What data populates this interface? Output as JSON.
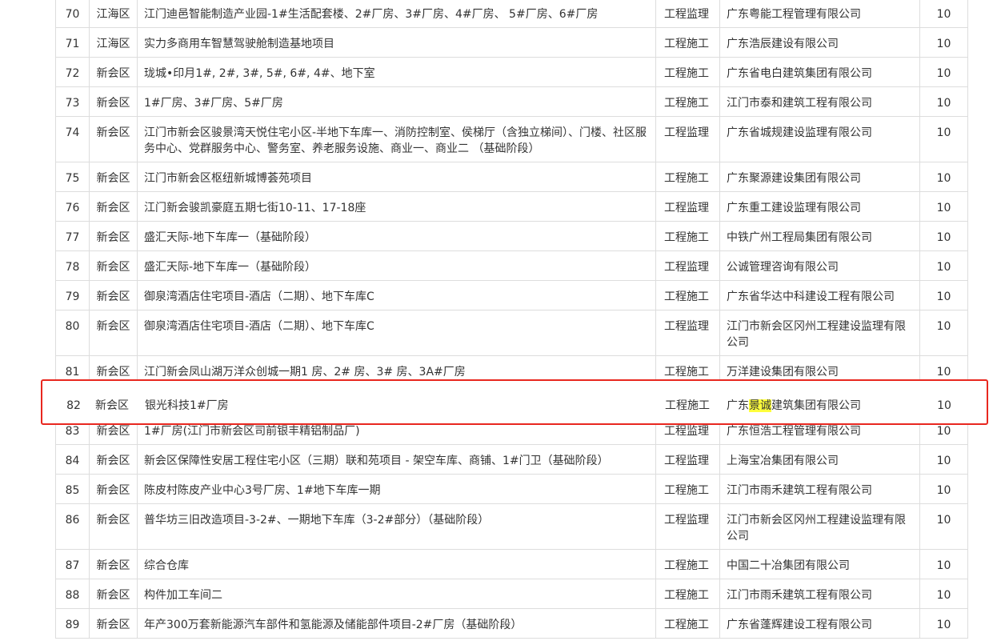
{
  "colors": {
    "border": "#dddddd",
    "text": "#333333",
    "highlight_box": "#e8271f",
    "text_highlight": "#ffff3c"
  },
  "rows": [
    {
      "num": "70",
      "district": "江海区",
      "project": "江门迪邑智能制造产业园-1#生活配套楼、2#厂房、3#厂房、4#厂房、 5#厂房、6#厂房",
      "type": "工程监理",
      "company": "广东粤能工程管理有限公司",
      "score": "10"
    },
    {
      "num": "71",
      "district": "江海区",
      "project": "实力多商用车智慧驾驶舱制造基地项目",
      "type": "工程施工",
      "company": "广东浩辰建设有限公司",
      "score": "10"
    },
    {
      "num": "72",
      "district": "新会区",
      "project": "珑城•印月1#, 2#, 3#, 5#, 6#, 4#、地下室",
      "type": "工程施工",
      "company": "广东省电白建筑集团有限公司",
      "score": "10"
    },
    {
      "num": "73",
      "district": "新会区",
      "project": "1#厂房、3#厂房、5#厂房",
      "type": "工程施工",
      "company": "江门市泰和建筑工程有限公司",
      "score": "10"
    },
    {
      "num": "74",
      "district": "新会区",
      "project": "江门市新会区骏景湾天悦住宅小区-半地下车库一、消防控制室、侯梯厅（含独立梯间）、门楼、社区服 务中心、党群服务中心、警务室、养老服务设施、商业一、商业二 （基础阶段）",
      "type": "工程监理",
      "company": "广东省城规建设监理有限公司",
      "score": "10"
    },
    {
      "num": "75",
      "district": "新会区",
      "project": "江门市新会区枢纽新城博荟苑项目",
      "type": "工程施工",
      "company": "广东聚源建设集团有限公司",
      "score": "10"
    },
    {
      "num": "76",
      "district": "新会区",
      "project": "江门新会骏凯豪庭五期七街10-11、17-18座",
      "type": "工程监理",
      "company": "广东重工建设监理有限公司",
      "score": "10"
    },
    {
      "num": "77",
      "district": "新会区",
      "project": "盛汇天际-地下车库一（基础阶段）",
      "type": "工程施工",
      "company": "中铁广州工程局集团有限公司",
      "score": "10"
    },
    {
      "num": "78",
      "district": "新会区",
      "project": "盛汇天际-地下车库一（基础阶段）",
      "type": "工程监理",
      "company": "公诚管理咨询有限公司",
      "score": "10"
    },
    {
      "num": "79",
      "district": "新会区",
      "project": "御泉湾酒店住宅项目-酒店（二期）、地下车库C",
      "type": "工程施工",
      "company": "广东省华达中科建设工程有限公司",
      "score": "10"
    },
    {
      "num": "80",
      "district": "新会区",
      "project": "御泉湾酒店住宅项目-酒店（二期）、地下车库C",
      "type": "工程监理",
      "company": "江门市新会区冈州工程建设监理有限公司",
      "score": "10"
    },
    {
      "num": "81",
      "district": "新会区",
      "project": "江门新会凤山湖万洋众创城一期1 房、2# 房、3# 房、3A#厂房",
      "type": "工程施工",
      "company": "万洋建设集团有限公司",
      "score": "10"
    },
    {
      "num": "82",
      "district": "新会区",
      "project": "银光科技1#厂房",
      "type": "工程施工",
      "company": "广东景诚建筑集团有限公司",
      "score": "10"
    },
    {
      "num": "83",
      "district": "新会区",
      "project": "1#厂房(江门市新会区司前银丰精铝制品厂)",
      "type": "工程监理",
      "company": "广东恒浩工程管理有限公司",
      "score": "10"
    },
    {
      "num": "84",
      "district": "新会区",
      "project": "新会区保障性安居工程住宅小区（三期）联和苑项目 - 架空车库、商铺、1#门卫（基础阶段）",
      "type": "工程监理",
      "company": "上海宝冶集团有限公司",
      "score": "10"
    },
    {
      "num": "85",
      "district": "新会区",
      "project": "陈皮村陈皮产业中心3号厂房、1#地下车库一期",
      "type": "工程施工",
      "company": "江门市雨禾建筑工程有限公司",
      "score": "10"
    },
    {
      "num": "86",
      "district": "新会区",
      "project": "普华坊三旧改造项目-3-2#、一期地下车库（3-2#部分）（基础阶段）",
      "type": "工程监理",
      "company": "江门市新会区冈州工程建设监理有限公司",
      "score": "10"
    },
    {
      "num": "87",
      "district": "新会区",
      "project": "综合仓库",
      "type": "工程施工",
      "company": "中国二十冶集团有限公司",
      "score": "10"
    },
    {
      "num": "88",
      "district": "新会区",
      "project": "构件加工车间二",
      "type": "工程施工",
      "company": "江门市雨禾建筑工程有限公司",
      "score": "10"
    },
    {
      "num": "89",
      "district": "新会区",
      "project": "年产300万套新能源汽车部件和氢能源及储能部件项目-2#厂房（基础阶段）",
      "type": "工程施工",
      "company": "广东省蓬辉建设工程有限公司",
      "score": "10"
    }
  ],
  "highlighted": {
    "num": "82",
    "district": "新会区",
    "project": "银光科技1#厂房",
    "type": "工程施工",
    "company_prefix": "广东",
    "company_marked": "景诚",
    "company_suffix": "建筑集团有限公司",
    "score": "10"
  }
}
